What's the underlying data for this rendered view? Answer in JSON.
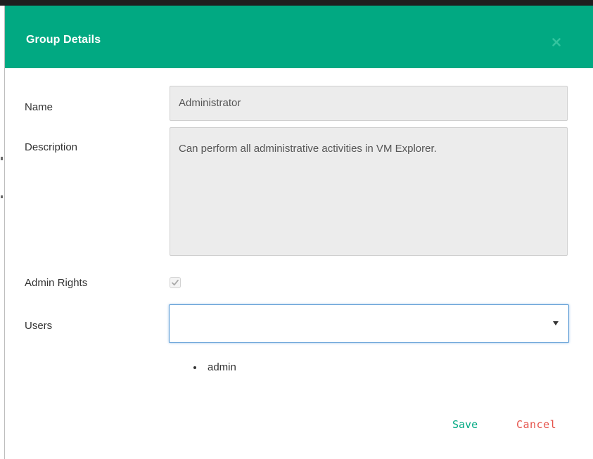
{
  "dialog": {
    "title": "Group Details",
    "close_icon": "close-icon"
  },
  "form": {
    "name": {
      "label": "Name",
      "value": "Administrator"
    },
    "description": {
      "label": "Description",
      "value": "Can perform all administrative activities in VM Explorer."
    },
    "admin_rights": {
      "label": "Admin Rights",
      "checked": true
    },
    "users": {
      "label": "Users",
      "selected": "",
      "items": [
        {
          "name": "admin"
        }
      ]
    }
  },
  "actions": {
    "save_label": "Save",
    "cancel_label": "Cancel"
  },
  "colors": {
    "header": "#01a982",
    "save": "#01a982",
    "cancel": "#e5534b",
    "focus_border": "#5b9bd5"
  }
}
